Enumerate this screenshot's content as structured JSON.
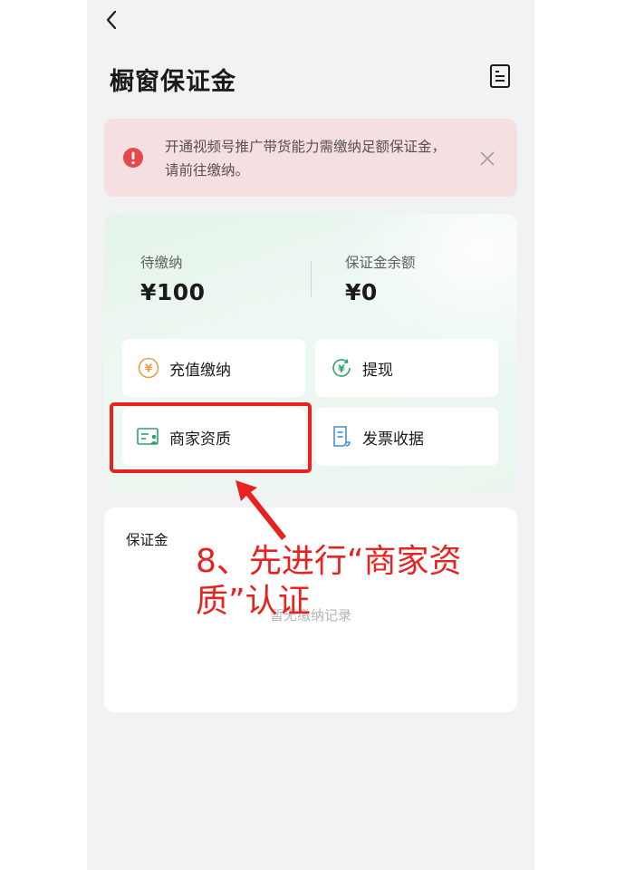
{
  "header": {
    "title": "橱窗保证金",
    "back_icon": "chevron-left-icon",
    "records_icon": "document-list-icon"
  },
  "alert": {
    "text": "开通视频号推广带货能力需缴纳足额保证金，请前往缴纳。",
    "icon": "exclamation-circle-icon",
    "close_icon": "close-icon",
    "accent_color": "#e5484d",
    "background": "#f6dfe0"
  },
  "summary": {
    "pending_label": "待缴纳",
    "pending_value": "¥100",
    "balance_label": "保证金余额",
    "balance_value": "¥0"
  },
  "actions": [
    {
      "label": "充值缴纳",
      "icon": "yen-coin-icon",
      "color": "#e8a04a"
    },
    {
      "label": "提现",
      "icon": "yen-refresh-icon",
      "color": "#2ba466"
    },
    {
      "label": "商家资质",
      "icon": "id-card-icon",
      "color": "#2ba466"
    },
    {
      "label": "发票收据",
      "icon": "receipt-icon",
      "color": "#3f8fd8"
    }
  ],
  "deposit_section": {
    "title": "保证金",
    "empty_text": "暂无缴纳记录"
  },
  "annotation": {
    "text": "8、先进行“商家资质”认证",
    "color": "#e8231f"
  }
}
